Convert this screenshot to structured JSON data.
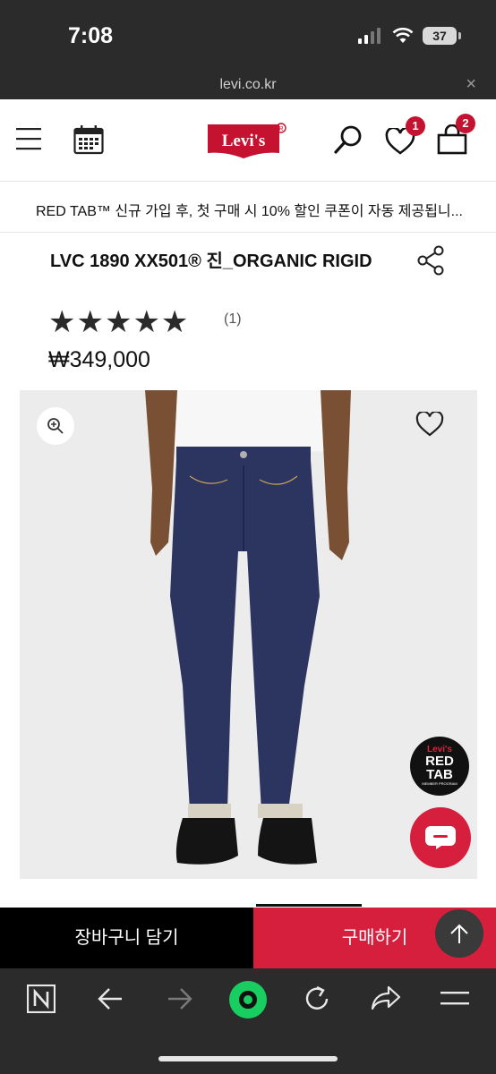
{
  "status": {
    "time": "7:08",
    "battery": "37"
  },
  "browser": {
    "url": "levi.co.kr",
    "close_glyph": "×"
  },
  "header": {
    "logo": "Levi's",
    "wishlist_count": "1",
    "cart_count": "2"
  },
  "promo": {
    "text": "RED TAB™ 신규 가입 후, 첫 구매 시 10% 할인 쿠폰이 자동 제공됩니..."
  },
  "product": {
    "title": "LVC 1890 XX501® 진_ORGANIC RIGID",
    "rating": 5,
    "stars": "★★★★★",
    "review_count": "(1)",
    "price": "₩349,000"
  },
  "badge": {
    "line1": "Levi's",
    "line2": "RED",
    "line3": "TAB",
    "line4": "MEMBER PROGRAM"
  },
  "actions": {
    "cart_label": "장바구니 담기",
    "buy_label": "구매하기"
  },
  "colors": {
    "brand_red": "#c41230",
    "buy_red": "#d61f3d",
    "dark_bar": "#2b2b2b",
    "jeans": "#2b3560"
  }
}
